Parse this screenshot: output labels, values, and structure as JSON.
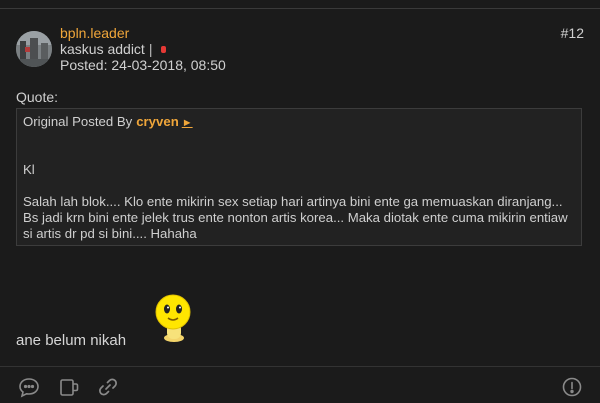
{
  "post": {
    "username": "bpln.leader",
    "rank": "kaskus addict",
    "rank_separator": "|",
    "posted": "Posted: 24-03-2018, 08:50",
    "number": "#12",
    "status_color": "#e53935"
  },
  "quote": {
    "label": "Quote:",
    "original_prefix": "Original Posted By",
    "author": "cryven",
    "author_arrow": "►",
    "line1": "Kl",
    "line2": "Salah lah blok.... Klo ente mikirin sex setiap hari artinya bini ente ga memuaskan diranjang... Bs jadi krn bini ente jelek trus ente nonton artis korea... Maka diotak ente cuma mikirin entiaw si artis dr pd si bini.... Hahaha"
  },
  "body": {
    "text": "ane belum nikah",
    "emoticon": "smiley-emoticon"
  },
  "actions": {
    "icons": [
      "comment-icon",
      "mug-icon",
      "link-icon",
      "report-icon"
    ]
  },
  "colors": {
    "background": "#1b1b1b",
    "accent": "#f0a63a"
  }
}
